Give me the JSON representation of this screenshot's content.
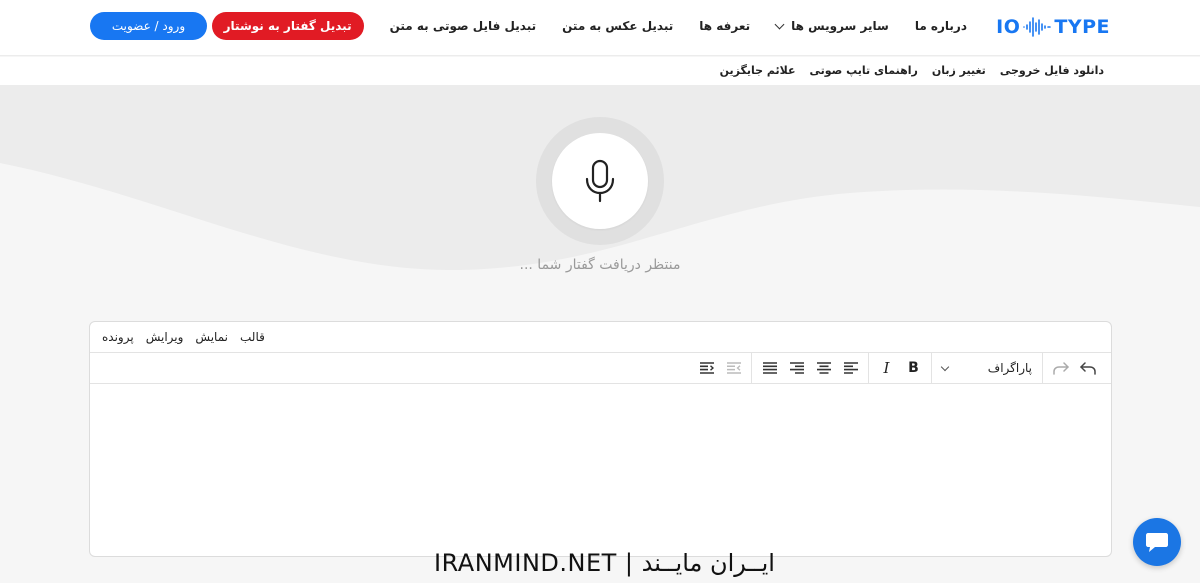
{
  "header": {
    "logo": {
      "left": "IO",
      "right": "TYPE",
      "color": "#1877f2"
    },
    "cta_label": "تبدیل گفتار به نوشتار",
    "nav": [
      {
        "label": "تبدیل فایل صوتی به متن"
      },
      {
        "label": "تبدیل عکس به متن"
      },
      {
        "label": "تعرفه ها"
      },
      {
        "label": "سایر سرویس ها"
      },
      {
        "label": "درباره ما"
      }
    ],
    "login_label": "ورود / عضویت"
  },
  "subnav": {
    "items": [
      {
        "label": "علائم جایگزین"
      },
      {
        "label": "راهنمای تایپ صوتی"
      },
      {
        "label": "تغییر زبان"
      },
      {
        "label": "دانلود فایل خروجی"
      }
    ]
  },
  "hero": {
    "mic_icon": "microphone-icon",
    "status_text": "منتظر دریافت گفتار شما ..."
  },
  "editor": {
    "menus": [
      {
        "label": "پرونده"
      },
      {
        "label": "ویرایش"
      },
      {
        "label": "نمایش"
      },
      {
        "label": "قالب"
      }
    ],
    "format_select": "پاراگراف",
    "bold_label": "B",
    "italic_label": "I"
  },
  "watermark": "IRANMIND.NET | ایــران مایــند",
  "colors": {
    "brand": "#1877f2",
    "cta": "#e11b24",
    "chat": "#1b76e4"
  }
}
